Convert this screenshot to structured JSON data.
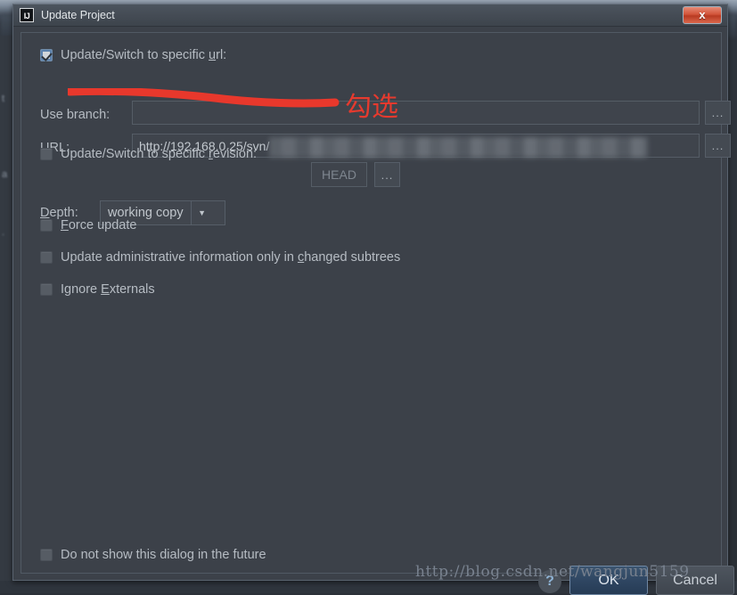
{
  "window": {
    "title": "Update Project",
    "app_icon": "IJ",
    "close_label": "x"
  },
  "form": {
    "switch_url": {
      "label_before": "Update/Switch to specific ",
      "label_mnemonic": "u",
      "label_after": "rl:",
      "checked": true
    },
    "use_branch": {
      "label": "Use branch:",
      "value": "",
      "browse_label": "..."
    },
    "url": {
      "label": "URL:",
      "value": "http://192.168.0.25/svn/",
      "browse_label": "..."
    },
    "switch_revision": {
      "label_before": "Update/Switch to specific ",
      "label_mnemonic": "r",
      "label_after": "evision:",
      "checked": false,
      "revision_value": "HEAD",
      "browse_label": "..."
    },
    "depth": {
      "label_mnemonic": "D",
      "label_after": "epth:",
      "selected": "working copy",
      "options": [
        "working copy"
      ],
      "arrow_icon": "▼"
    },
    "force_update": {
      "label_mnemonic": "F",
      "label_after": "orce update",
      "checked": false
    },
    "update_admin": {
      "label_before": "Update administrative information only in ",
      "label_mnemonic": "c",
      "label_after": "hanged subtrees",
      "checked": false
    },
    "ignore_externals": {
      "label_before": "Ignore ",
      "label_mnemonic": "E",
      "label_after": "xternals",
      "checked": false
    }
  },
  "footer": {
    "do_not_show": {
      "label": "Do not show this dialog in the future",
      "checked": false
    },
    "help_label": "?",
    "ok_label": "OK",
    "cancel_label": "Cancel"
  },
  "annotations": {
    "underline_color": "#e8382c",
    "note_text": "勾选",
    "note_color": "#e53a2e"
  },
  "watermark": {
    "text": "http://blog.csdn.net/wangjun5159"
  },
  "background": {
    "edge_fragments": [
      "t",
      "a",
      "."
    ],
    "bottom_fragment": ""
  },
  "colors": {
    "dialog_bg": "#3c4149",
    "titlebar": "#454c55",
    "text": "#b6bcc3",
    "accent_ok": "#2f4662",
    "close_red": "#d2543a"
  }
}
